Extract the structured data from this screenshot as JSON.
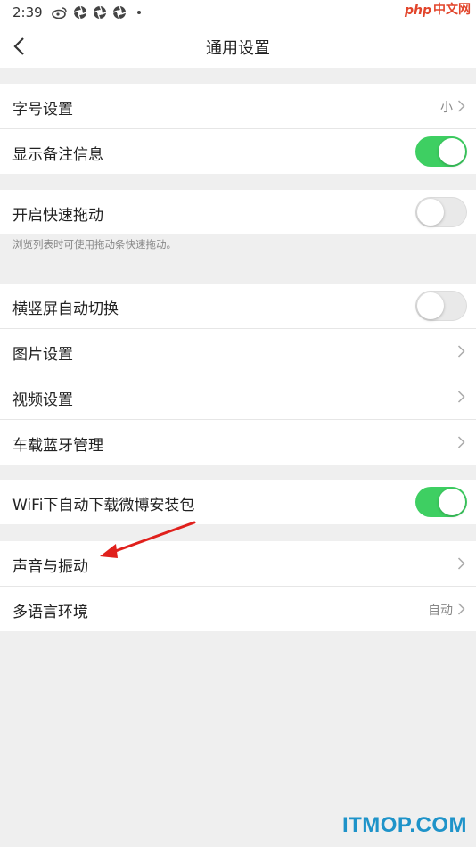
{
  "status_bar": {
    "time": "2:39",
    "icons": [
      "weibo-icon",
      "aperture-icon",
      "aperture-icon",
      "aperture-icon"
    ]
  },
  "watermark_top": {
    "php": "php",
    "rest": "中文网"
  },
  "nav": {
    "title": "通用设置",
    "back_icon": "chevron-left-icon"
  },
  "groups": {
    "g1": [
      {
        "label": "字号设置",
        "value": "小",
        "control": "chevron"
      },
      {
        "label": "显示备注信息",
        "control": "toggle",
        "on": true
      }
    ],
    "g2": [
      {
        "label": "开启快速拖动",
        "control": "toggle",
        "on": false
      }
    ],
    "g2_hint": "浏览列表时可使用拖动条快速拖动。",
    "g3": [
      {
        "label": "横竖屏自动切换",
        "control": "toggle",
        "on": false
      },
      {
        "label": "图片设置",
        "control": "chevron"
      },
      {
        "label": "视频设置",
        "control": "chevron"
      },
      {
        "label": "车载蓝牙管理",
        "control": "chevron"
      }
    ],
    "g4": [
      {
        "label": "WiFi下自动下载微博安装包",
        "control": "toggle",
        "on": true
      }
    ],
    "g5": [
      {
        "label": "声音与振动",
        "control": "chevron"
      },
      {
        "label": "多语言环境",
        "value": "自动",
        "control": "chevron"
      }
    ]
  },
  "watermark_bottom": "ITMOP.COM",
  "colors": {
    "toggle_on": "#3ecf62",
    "annotation_arrow": "#e0201c",
    "itmop_blue": "#1e93c9"
  }
}
